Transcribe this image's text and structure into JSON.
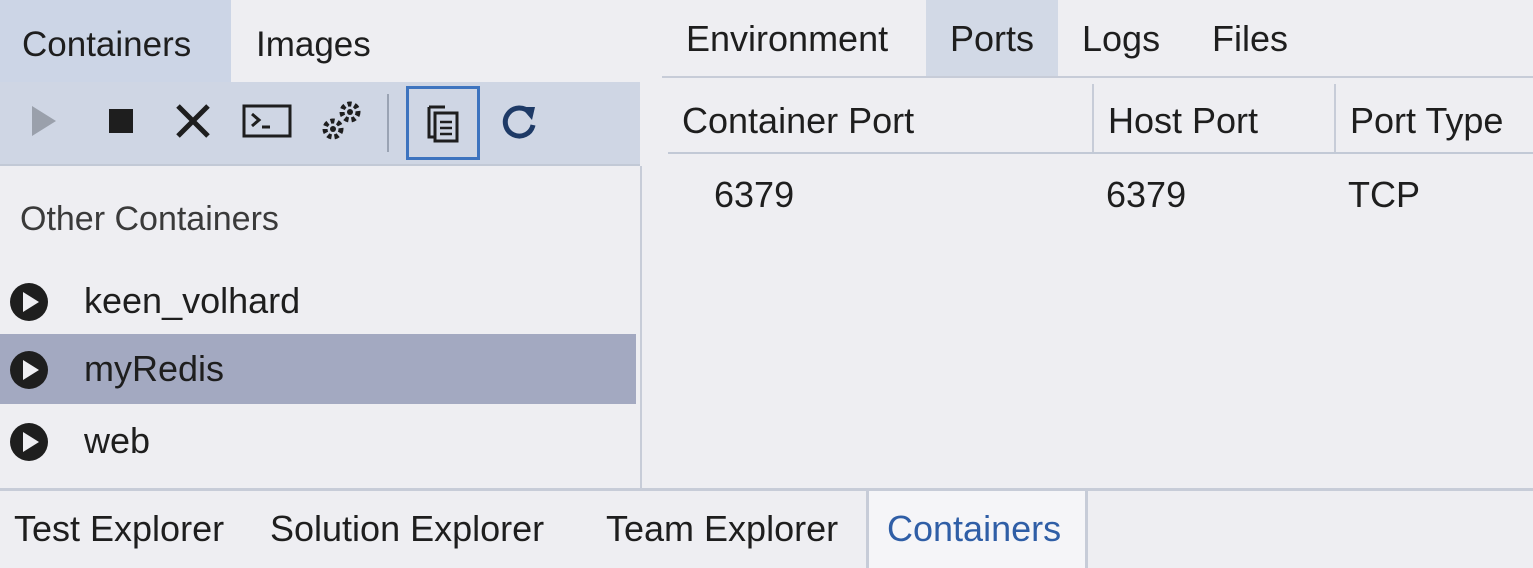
{
  "left_tabs": [
    {
      "label": "Containers",
      "active": true
    },
    {
      "label": "Images",
      "active": false
    }
  ],
  "toolbar": {
    "buttons": [
      {
        "icon": "play-icon",
        "enabled": false
      },
      {
        "icon": "stop-icon",
        "enabled": true
      },
      {
        "icon": "close-icon",
        "enabled": true
      },
      {
        "icon": "terminal-icon",
        "enabled": true
      },
      {
        "icon": "settings-gears-icon",
        "enabled": true
      },
      {
        "icon": "copy-files-icon",
        "selected": true
      },
      {
        "icon": "refresh-icon",
        "enabled": true
      }
    ]
  },
  "containers": {
    "group_label": "Other Containers",
    "items": [
      {
        "name": "keen_volhard",
        "selected": false
      },
      {
        "name": "myRedis",
        "selected": true
      },
      {
        "name": "web",
        "selected": false
      }
    ]
  },
  "detail_tabs": [
    {
      "label": "Environment",
      "active": false
    },
    {
      "label": "Ports",
      "active": true
    },
    {
      "label": "Logs",
      "active": false
    },
    {
      "label": "Files",
      "active": false
    }
  ],
  "ports_table": {
    "columns": [
      "Container Port",
      "Host Port",
      "Port Type"
    ],
    "rows": [
      [
        "6379",
        "6379",
        "TCP"
      ]
    ]
  },
  "bottom_tabs": [
    {
      "label": "Test Explorer",
      "active": false
    },
    {
      "label": "Solution Explorer",
      "active": false
    },
    {
      "label": "Team Explorer",
      "active": false
    },
    {
      "label": "Containers",
      "active": true
    }
  ],
  "colors": {
    "accent": "#3e74bf",
    "selected_row": "#a3a9c1",
    "toolbar_bg": "#cfd6e4",
    "active_bottom_tab_text": "#2f5ea6"
  }
}
